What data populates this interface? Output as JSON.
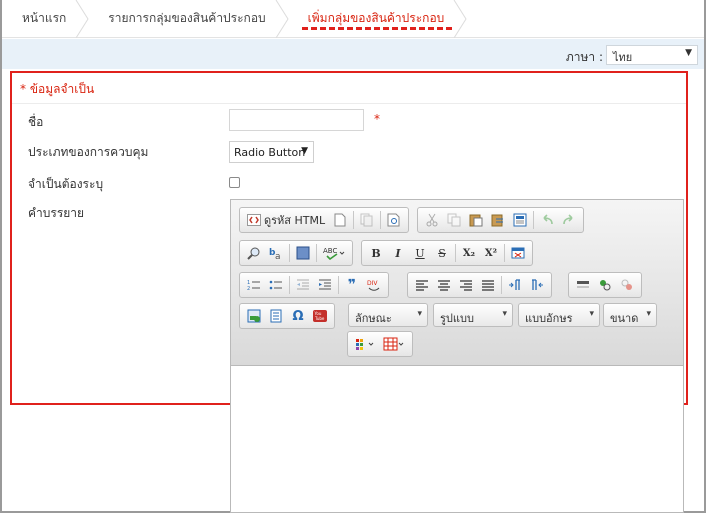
{
  "breadcrumb": {
    "items": [
      {
        "label": "หน้าแรก"
      },
      {
        "label": "รายการกลุ่มของสินค้าประกอบ"
      },
      {
        "label": "เพิ่มกลุ่มของสินค้าประกอบ"
      }
    ]
  },
  "language": {
    "label": "ภาษา :",
    "selected": "ไทย"
  },
  "section": {
    "title": "* ข้อมูลจำเป็น"
  },
  "form": {
    "name_label": "ชื่อ",
    "name_value": "",
    "required_mark": "*",
    "control_type_label": "ประเภทของการควบคุม",
    "control_type_value": "Radio Button",
    "required_label": "จำเป็นต้องระบุ",
    "description_label": "คำบรรยาย"
  },
  "editor": {
    "source_label": "ดูรหัส HTML",
    "bold": "B",
    "italic": "I",
    "underline": "U",
    "strike": "S",
    "sub": "X₂",
    "sup": "X²",
    "quote": "❞",
    "style_combo": "ลักษณะ",
    "format_combo": "รูปแบบ",
    "font_combo": "แบบอักษร",
    "size_combo": "ขนาด",
    "omega": "Ω"
  },
  "colors": {
    "highlight": "#e0211c",
    "langbar": "#e8f1f9"
  }
}
